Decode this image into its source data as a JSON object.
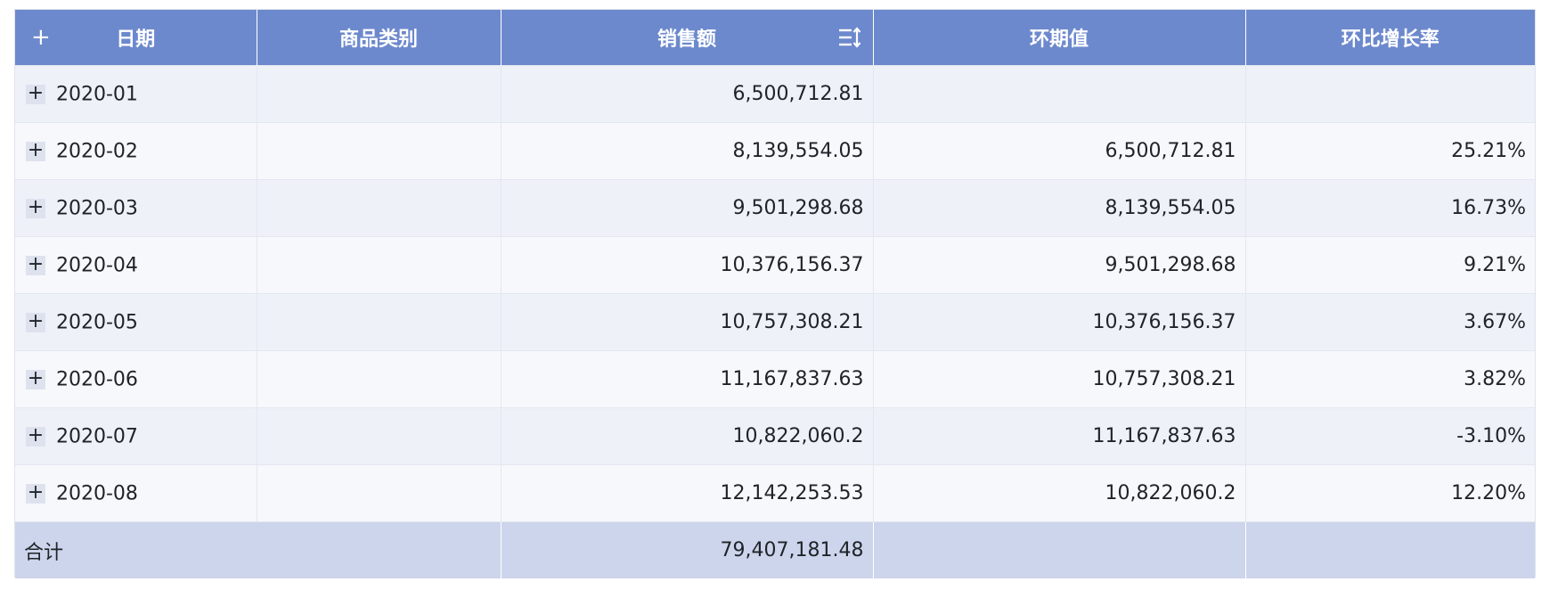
{
  "table": {
    "headers": {
      "expand_all": "+",
      "date": "日期",
      "category": "商品类别",
      "sales": "销售额",
      "prev_value": "环期值",
      "growth_rate": "环比增长率"
    },
    "sort_icon": "sort-icon",
    "expand_icon": "plus-icon",
    "rows": [
      {
        "expand": "+",
        "date": "2020-01",
        "category": "",
        "sales": "6,500,712.81",
        "prev_value": "",
        "growth_rate": ""
      },
      {
        "expand": "+",
        "date": "2020-02",
        "category": "",
        "sales": "8,139,554.05",
        "prev_value": "6,500,712.81",
        "growth_rate": "25.21%"
      },
      {
        "expand": "+",
        "date": "2020-03",
        "category": "",
        "sales": "9,501,298.68",
        "prev_value": "8,139,554.05",
        "growth_rate": "16.73%"
      },
      {
        "expand": "+",
        "date": "2020-04",
        "category": "",
        "sales": "10,376,156.37",
        "prev_value": "9,501,298.68",
        "growth_rate": "9.21%"
      },
      {
        "expand": "+",
        "date": "2020-05",
        "category": "",
        "sales": "10,757,308.21",
        "prev_value": "10,376,156.37",
        "growth_rate": "3.67%"
      },
      {
        "expand": "+",
        "date": "2020-06",
        "category": "",
        "sales": "11,167,837.63",
        "prev_value": "10,757,308.21",
        "growth_rate": "3.82%"
      },
      {
        "expand": "+",
        "date": "2020-07",
        "category": "",
        "sales": "10,822,060.2",
        "prev_value": "11,167,837.63",
        "growth_rate": "-3.10%"
      },
      {
        "expand": "+",
        "date": "2020-08",
        "category": "",
        "sales": "12,142,253.53",
        "prev_value": "10,822,060.2",
        "growth_rate": "12.20%"
      }
    ],
    "total": {
      "label": "合计",
      "sales": "79,407,181.48",
      "prev_value": "",
      "growth_rate": ""
    }
  },
  "colors": {
    "header_bg": "#6d89cd",
    "row_odd_bg": "#eef1f8",
    "row_even_bg": "#f7f8fc",
    "total_bg": "#ccd5eb"
  }
}
